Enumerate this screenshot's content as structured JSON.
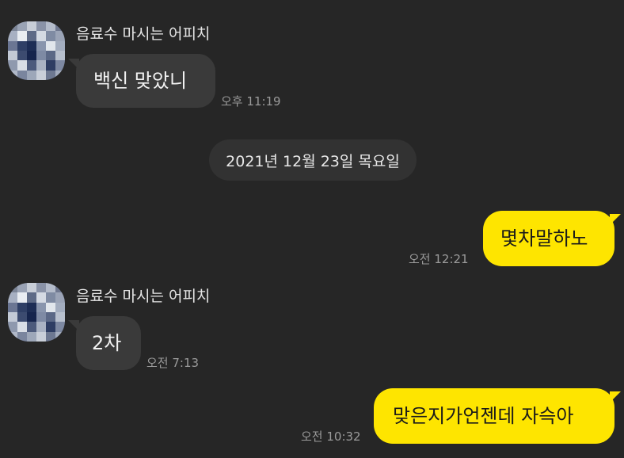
{
  "chat": {
    "date_divider": "2021년 12월 23일 목요일",
    "messages": [
      {
        "sender": "음료수 마시는 어피치",
        "text": "백신 맞았니",
        "time": "오후 11:19"
      },
      {
        "text": "몇차말하노",
        "time": "오전 12:21"
      },
      {
        "sender": "음료수 마시는 어피치",
        "text": "2차",
        "time": "오전 7:13"
      },
      {
        "text": "맞은지가언젠데 자슥아",
        "time": "오전 10:32"
      }
    ]
  },
  "colors": {
    "background": "#262626",
    "incoming_bubble": "#3a3a3a",
    "outgoing_bubble": "#fee500",
    "timestamp": "#9a9a9a"
  },
  "icons": {
    "avatar": "pixelated-profile-avatar-icon"
  }
}
